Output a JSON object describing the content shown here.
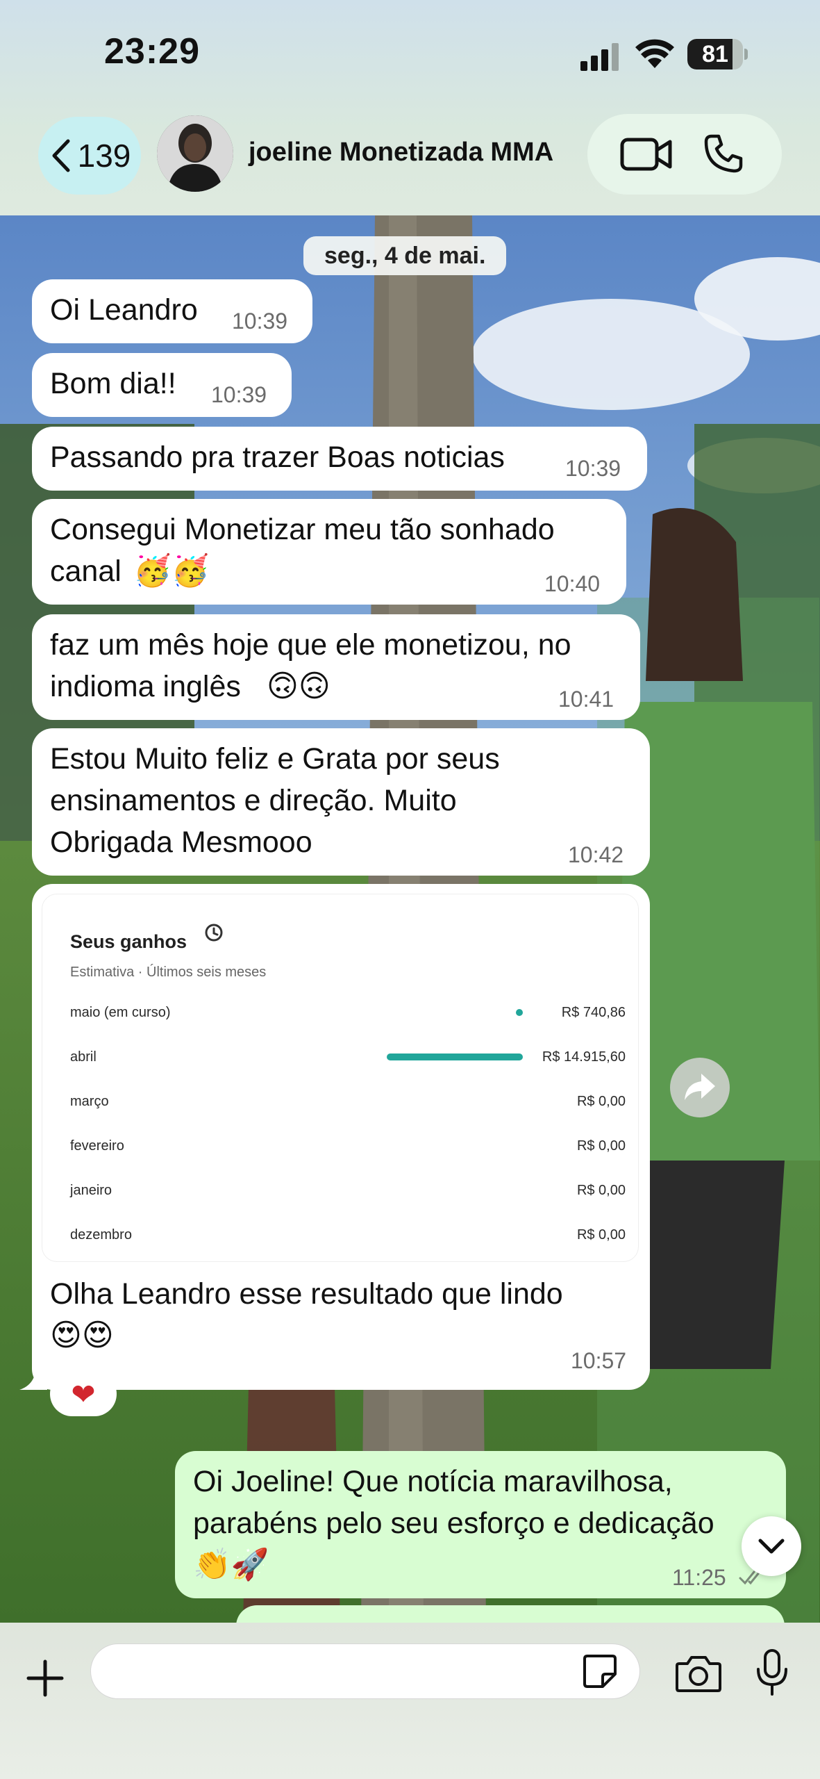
{
  "status_bar": {
    "time": "23:29",
    "battery": "81",
    "battery_level": 0.81
  },
  "header": {
    "back_count": "139",
    "contact_name": "joeline Monetizada MMA",
    "icons": [
      "chevron-left-icon",
      "video-call-icon",
      "phone-icon"
    ]
  },
  "chat": {
    "date_label": "seg., 4 de mai.",
    "messages": [
      {
        "dir": "in",
        "text": "Oi Leandro",
        "time": "10:39"
      },
      {
        "dir": "in",
        "text": "Bom dia!!",
        "time": "10:39"
      },
      {
        "dir": "in",
        "text": "Passando pra trazer Boas noticias",
        "time": "10:39"
      },
      {
        "dir": "in",
        "text_line1": "Consegui Monetizar meu tão sonhado",
        "text_line2": "canal",
        "emoji": "🥳🥳",
        "time": "10:40"
      },
      {
        "dir": "in",
        "text_line1": "faz um mês hoje que ele monetizou, no",
        "text_line2": "indioma inglês",
        "emoji": "🙃🙃",
        "time": "10:41"
      },
      {
        "dir": "in",
        "text_line1": "Estou Muito feliz e Grata por seus",
        "text_line2": "ensinamentos e direção. Muito",
        "text_line3": "Obrigada Mesmooo",
        "time": "10:42"
      },
      {
        "dir": "in",
        "caption_line1": "Olha Leandro esse resultado que lindo",
        "emoji": "😍😍",
        "time": "10:57",
        "reaction": "❤"
      },
      {
        "dir": "out",
        "text_line1": "Oi Joeline! Que notícia maravilhosa,",
        "text_line2": "parabéns pelo seu esforço e dedicação",
        "emoji": "👏🚀",
        "time": "11:25",
        "status": "read"
      }
    ],
    "earnings": {
      "title": "Seus ganhos",
      "subtitle": "Estimativa · Últimos seis meses",
      "accent": "#21a69a",
      "rows": [
        {
          "label": "maio (em curso)",
          "value": "R$ 740,86",
          "amount": 740.86
        },
        {
          "label": "abril",
          "value": "R$ 14.915,60",
          "amount": 14915.6
        },
        {
          "label": "março",
          "value": "R$ 0,00",
          "amount": 0
        },
        {
          "label": "fevereiro",
          "value": "R$ 0,00",
          "amount": 0
        },
        {
          "label": "janeiro",
          "value": "R$ 0,00",
          "amount": 0
        },
        {
          "label": "dezembro",
          "value": "R$ 0,00",
          "amount": 0
        }
      ]
    }
  },
  "composer": {
    "placeholder": "",
    "icons": [
      "plus-icon",
      "sticker-icon",
      "camera-icon",
      "microphone-icon"
    ]
  },
  "colors": {
    "incoming_bubble": "#ffffff",
    "outgoing_bubble": "#d8fdd2",
    "back_pill": "#c7f0f2"
  }
}
